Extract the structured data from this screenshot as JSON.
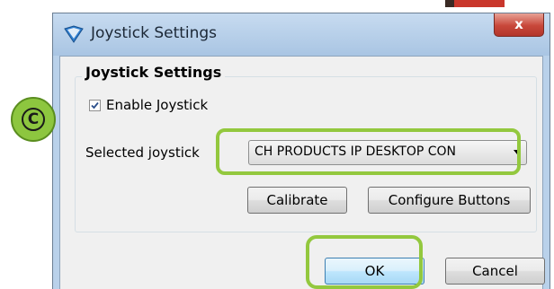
{
  "window": {
    "title": "Joystick Settings",
    "close_label": "x"
  },
  "group": {
    "title": "Joystick Settings",
    "enable_label": "Enable Joystick",
    "enable_checked": true,
    "selected_label": "Selected joystick",
    "selected_value": "CH PRODUCTS IP DESKTOP CON"
  },
  "buttons": {
    "calibrate": "Calibrate",
    "configure": "Configure Buttons",
    "ok": "OK",
    "cancel": "Cancel"
  },
  "annotation": {
    "callout_letter": "C",
    "highlight_color": "#93c83e"
  }
}
